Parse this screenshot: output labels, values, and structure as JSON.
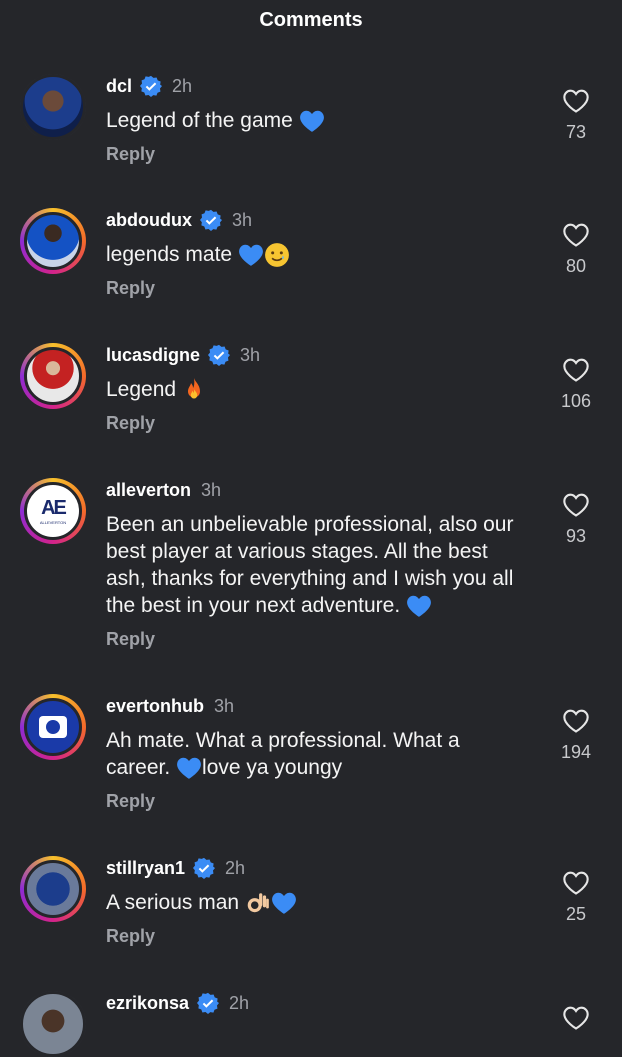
{
  "header": {
    "title": "Comments"
  },
  "comments": [
    {
      "username": "dcl",
      "verified": true,
      "time": "2h",
      "text": "Legend of the game",
      "emojis": [
        "blue-heart"
      ],
      "reply": "Reply",
      "likes": "73",
      "avatar": "dcl"
    },
    {
      "username": "abdoudux",
      "verified": true,
      "time": "3h",
      "text": "legends mate",
      "emojis": [
        "blue-heart",
        "smiling-face-with-tear"
      ],
      "reply": "Reply",
      "likes": "80",
      "avatar": "abd"
    },
    {
      "username": "lucasdigne",
      "verified": true,
      "time": "3h",
      "text": "Legend",
      "emojis": [
        "fire"
      ],
      "reply": "Reply",
      "likes": "106",
      "avatar": "luc"
    },
    {
      "username": "alleverton",
      "verified": false,
      "time": "3h",
      "text": "Been an unbelievable professional, also our best player at various stages. All the best ash, thanks for everything and I wish you all the best in your next adventure.",
      "emojis": [
        "blue-heart"
      ],
      "reply": "Reply",
      "likes": "93",
      "avatar": "all"
    },
    {
      "username": "evertonhub",
      "verified": false,
      "time": "3h",
      "text_part1": "Ah mate. What a professional. What a career.",
      "text_part2": "love ya youngy",
      "emojis": [
        "blue-heart"
      ],
      "reply": "Reply",
      "likes": "194",
      "avatar": "evh"
    },
    {
      "username": "stillryan1",
      "verified": true,
      "time": "2h",
      "text": "A serious man",
      "emojis": [
        "ok-hand",
        "blue-heart"
      ],
      "reply": "Reply",
      "likes": "25",
      "avatar": "stl"
    },
    {
      "username": "ezrikonsa",
      "verified": true,
      "time": "2h",
      "avatar": "ezr"
    }
  ],
  "avatar_logo_text": {
    "alleverton": "AE",
    "alleverton_small": "ALLEVERTON"
  },
  "colors": {
    "background": "#25262a",
    "verified": "#3b8cf5",
    "blue_heart": "#3b8cf5",
    "muted": "#a0a2a8"
  }
}
